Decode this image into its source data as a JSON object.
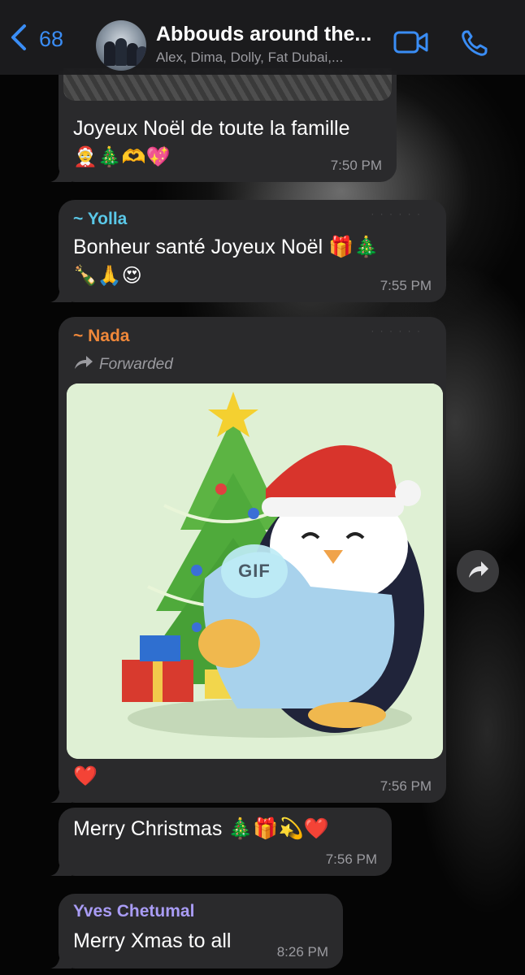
{
  "header": {
    "back_count": "68",
    "title": "Abbouds around the...",
    "subtitle": "Alex, Dima, Dolly, Fat Dubai,..."
  },
  "messages": [
    {
      "text": "Joyeux Noël de toute la famille",
      "emoji": "🤶🎄🫶💖",
      "time": "7:50 PM"
    },
    {
      "sender": "~ Yolla",
      "sender_color": "#5ac8e8",
      "text": "Bonheur santé Joyeux Noël 🎁🎄",
      "emoji": "🍾🙏😍",
      "time": "7:55 PM"
    },
    {
      "sender": "~ Nada",
      "sender_color": "#f0883a",
      "forwarded_label": "Forwarded",
      "gif_label": "GIF",
      "caption": "❤️",
      "time": "7:56 PM"
    },
    {
      "text": "Merry Christmas 🎄🎁💫❤️",
      "time": "7:56 PM"
    },
    {
      "sender": "Yves Chetumal",
      "sender_color": "#a99cf5",
      "text": "Merry Xmas to all",
      "time": "8:26 PM"
    }
  ],
  "colors": {
    "accent": "#3a8df5",
    "bubble": "#2a2a2c",
    "header_bg": "#1c1c1e"
  },
  "icons": {
    "back": "chevron-left-icon",
    "video": "video-camera-icon",
    "call": "phone-icon",
    "forward": "forward-arrow-icon",
    "forwarded": "forwarded-arrow-icon"
  }
}
